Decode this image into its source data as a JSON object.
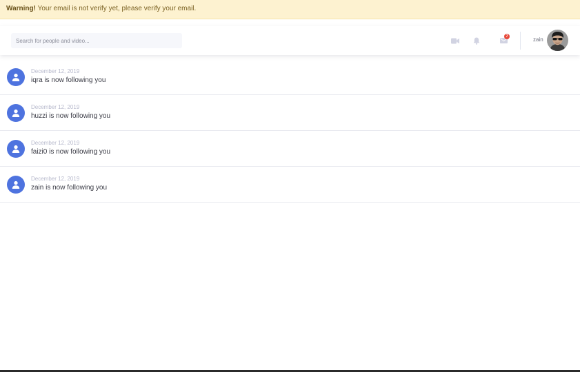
{
  "warning": {
    "strong": "Warning!",
    "text": " Your email is not verify yet, please verify your email."
  },
  "topbar": {
    "search_placeholder": "Search for people and video...",
    "icons": [
      "video-camera-icon",
      "bell-icon",
      "envelope-icon"
    ],
    "messages_badge": "7",
    "username": "zain"
  },
  "notifications": [
    {
      "date": "December 12, 2019",
      "message": "iqra is now following you"
    },
    {
      "date": "December 12, 2019",
      "message": "huzzi is now following you"
    },
    {
      "date": "December 12, 2019",
      "message": "faizi0 is now following you"
    },
    {
      "date": "December 12, 2019",
      "message": "zain is now following you"
    }
  ],
  "colors": {
    "warning_bg": "#fdf2d0",
    "accent": "#4e73df",
    "badge": "#e74a3b"
  }
}
